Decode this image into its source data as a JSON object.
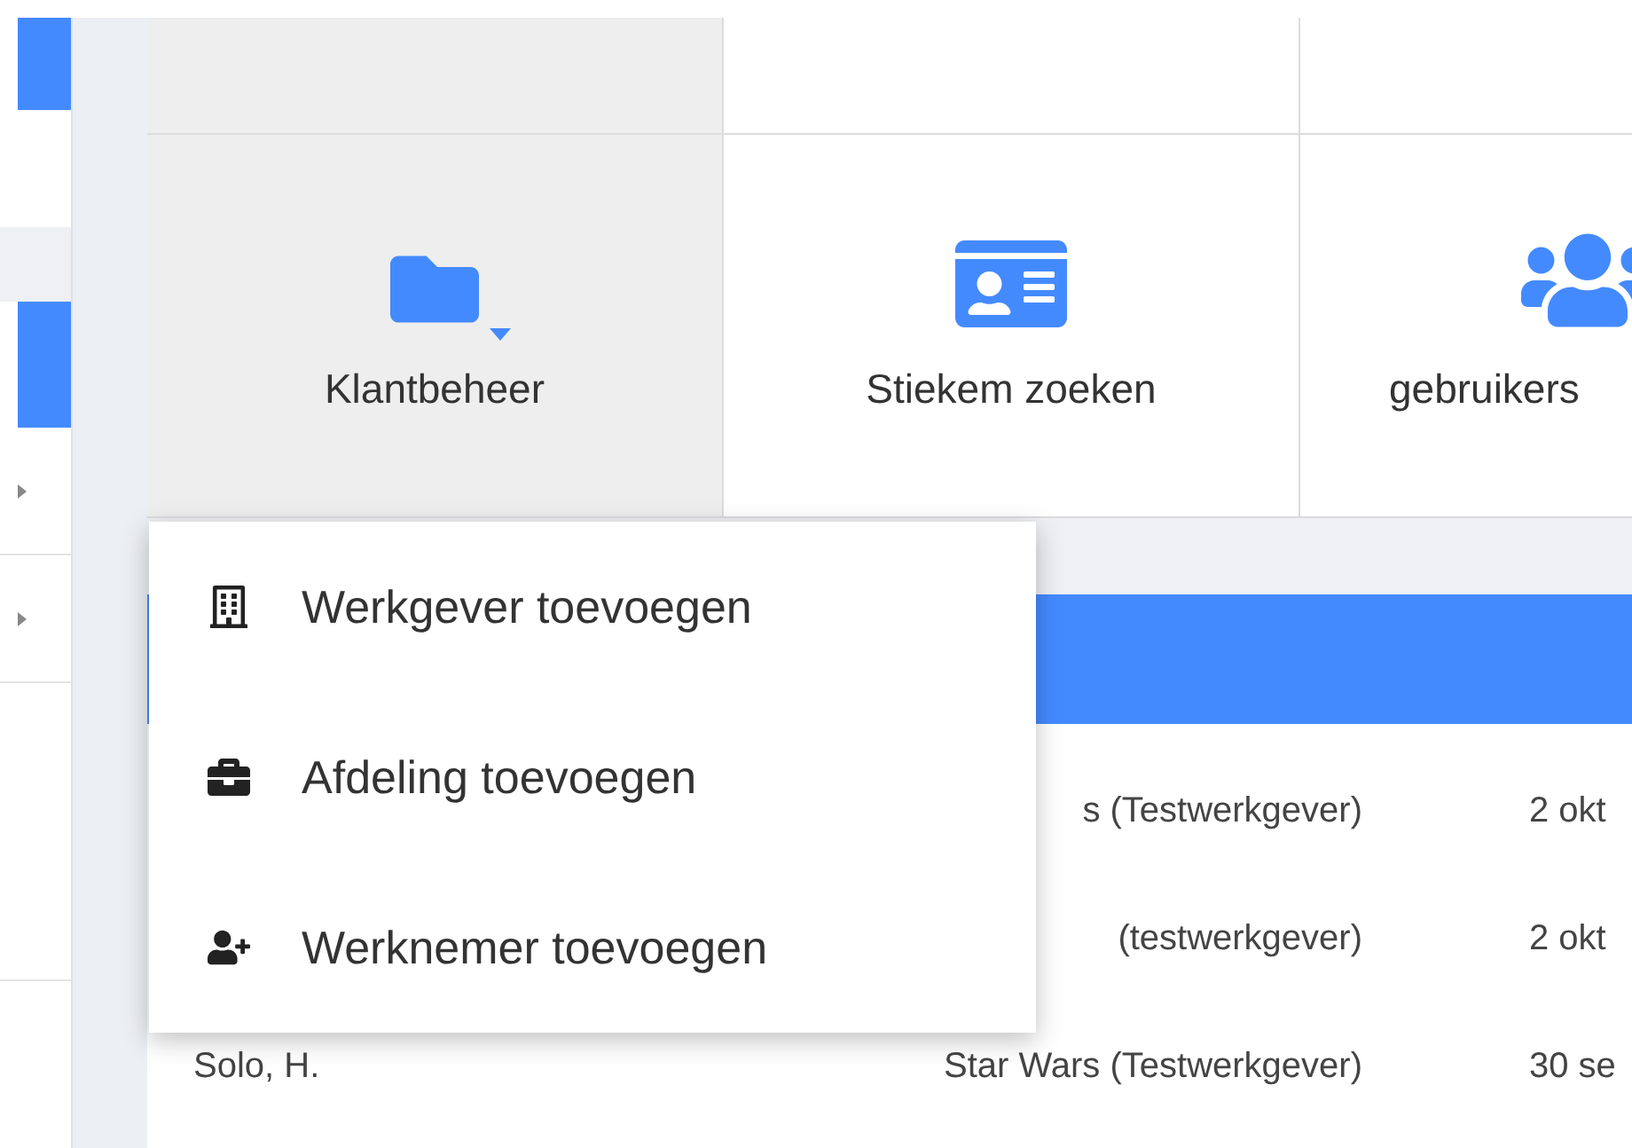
{
  "tiles": [
    {
      "kind": "folder",
      "label": "Klantbeheer",
      "selected": true,
      "dropdown": true
    },
    {
      "kind": "id-card",
      "label": "Stiekem zoeken",
      "selected": false,
      "dropdown": false
    },
    {
      "kind": "users",
      "label": "gebruikers",
      "selected": false,
      "dropdown": false
    }
  ],
  "dropdown_menu": [
    {
      "kind": "building",
      "label": "Werkgever toevoegen"
    },
    {
      "kind": "briefcase",
      "label": "Afdeling toevoegen"
    },
    {
      "kind": "user-plus",
      "label": "Werknemer toevoegen"
    }
  ],
  "table": {
    "rows": [
      [
        "",
        "s (Testwerkgever)",
        "2 okt"
      ],
      [
        "",
        "(testwerkgever)",
        "2 okt"
      ],
      [
        "Solo, H.",
        "Star Wars (Testwerkgever)",
        "30 se"
      ]
    ]
  }
}
